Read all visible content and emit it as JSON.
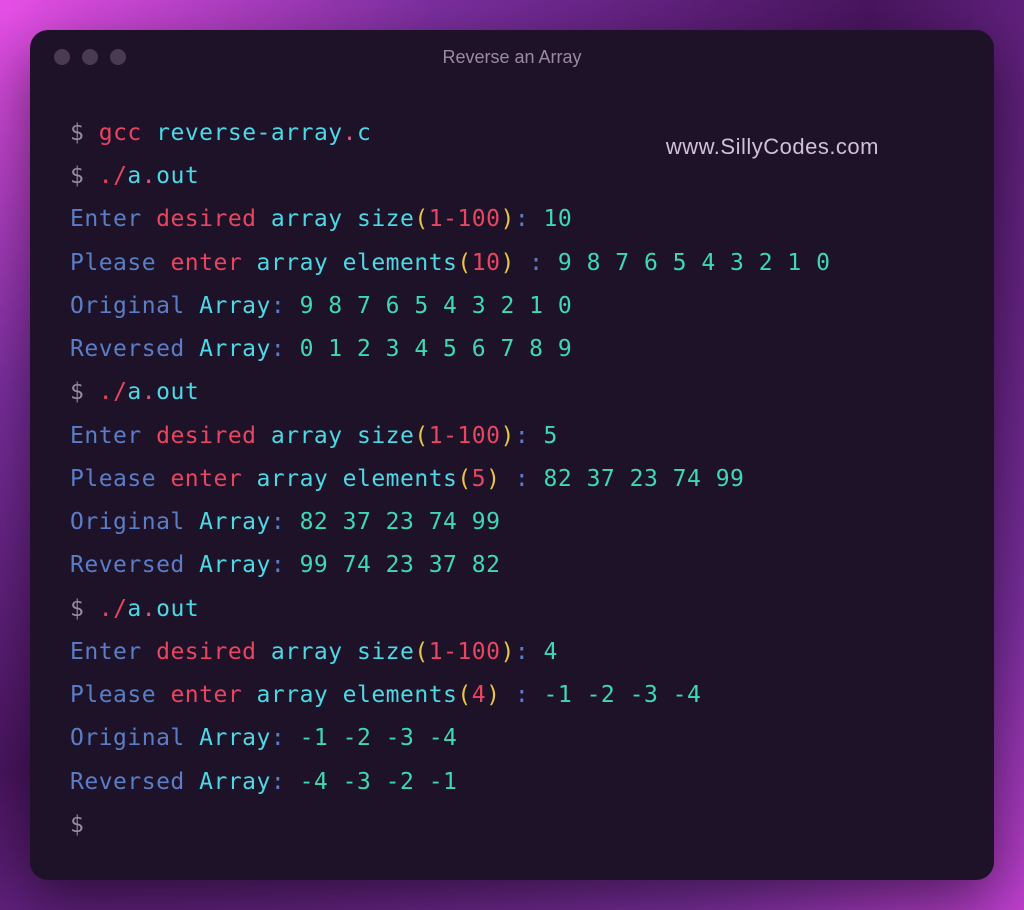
{
  "window": {
    "title": "Reverse an Array"
  },
  "watermark": "www.SillyCodes.com",
  "terminal": {
    "prompt": "$",
    "compile_cmd": {
      "gcc": "gcc",
      "file": "reverse-array",
      "dot": ".",
      "ext": "c"
    },
    "run_cmd": {
      "dotslash": "./",
      "a": "a",
      "dot": ".",
      "out": "out"
    },
    "runs": [
      {
        "size_prompt": {
          "enter": "Enter ",
          "desired": "desired ",
          "array": "array ",
          "size": "size",
          "lparen": "(",
          "range": "1-100",
          "rparen": ")",
          "colon": ": ",
          "value": "10"
        },
        "elements_prompt": {
          "please": "Please ",
          "enter": "enter ",
          "array": "array ",
          "elements": "elements",
          "lparen": "(",
          "count": "10",
          "rparen": ")",
          "colon": " : ",
          "values": "9 8 7 6 5 4 3 2 1 0"
        },
        "original": {
          "label1": "Original ",
          "label2": "Array",
          "colon": ": ",
          "values": "9 8 7 6 5 4 3 2 1 0"
        },
        "reversed": {
          "label1": "Reversed ",
          "label2": "Array",
          "colon": ": ",
          "values": "0 1 2 3 4 5 6 7 8 9"
        }
      },
      {
        "size_prompt": {
          "enter": "Enter ",
          "desired": "desired ",
          "array": "array ",
          "size": "size",
          "lparen": "(",
          "range": "1-100",
          "rparen": ")",
          "colon": ": ",
          "value": "5"
        },
        "elements_prompt": {
          "please": "Please ",
          "enter": "enter ",
          "array": "array ",
          "elements": "elements",
          "lparen": "(",
          "count": "5",
          "rparen": ")",
          "colon": " : ",
          "values": "82 37 23 74 99"
        },
        "original": {
          "label1": "Original ",
          "label2": "Array",
          "colon": ": ",
          "values": "82 37 23 74 99"
        },
        "reversed": {
          "label1": "Reversed ",
          "label2": "Array",
          "colon": ": ",
          "values": "99 74 23 37 82"
        }
      },
      {
        "size_prompt": {
          "enter": "Enter ",
          "desired": "desired ",
          "array": "array ",
          "size": "size",
          "lparen": "(",
          "range": "1-100",
          "rparen": ")",
          "colon": ": ",
          "value": "4"
        },
        "elements_prompt": {
          "please": "Please ",
          "enter": "enter ",
          "array": "array ",
          "elements": "elements",
          "lparen": "(",
          "count": "4",
          "rparen": ")",
          "colon": " : ",
          "values": "-1 -2 -3 -4"
        },
        "original": {
          "label1": "Original ",
          "label2": "Array",
          "colon": ": ",
          "values": "-1 -2 -3 -4"
        },
        "reversed": {
          "label1": "Reversed ",
          "label2": "Array",
          "colon": ": ",
          "values": "-4 -3 -2 -1"
        }
      }
    ]
  }
}
